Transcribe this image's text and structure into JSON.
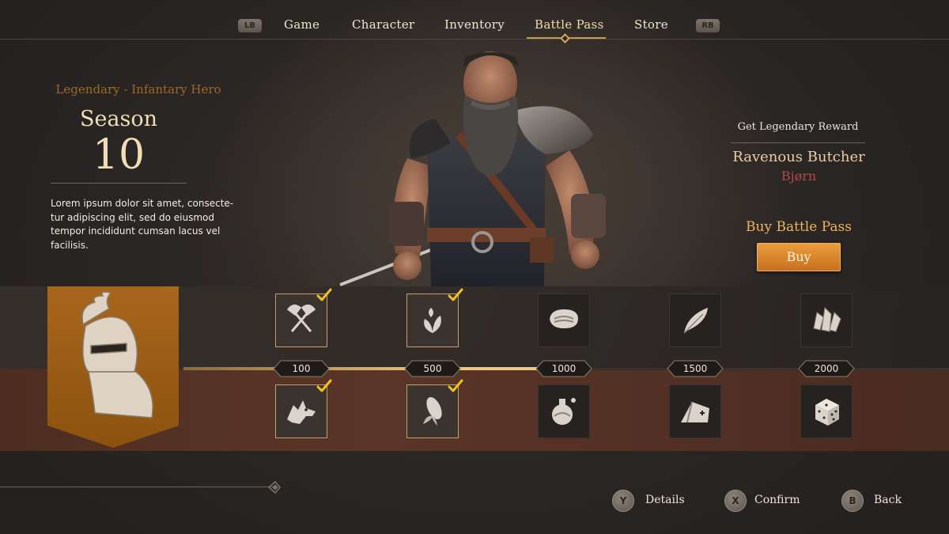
{
  "nav": {
    "left_bumper": "LB",
    "right_bumper": "RB",
    "tabs": [
      {
        "label": "Game"
      },
      {
        "label": "Character"
      },
      {
        "label": "Inventory"
      },
      {
        "label": "Battle Pass"
      },
      {
        "label": "Store"
      }
    ],
    "active_tab": "Battle Pass"
  },
  "season": {
    "rarity": "Legendary - Infantary Hero",
    "label": "Season",
    "number": "10",
    "description": "Lorem ipsum dolor sit amet, consecte-tur adipiscing elit, sed do eiusmod tempor incididunt cumsan lacus vel facilisis."
  },
  "reward": {
    "title": "Get Legendary Reward",
    "name": "Ravenous Butcher",
    "subtitle": "Bjørn"
  },
  "buy": {
    "title": "Buy Battle Pass",
    "button": "Buy"
  },
  "track": {
    "progress_fraction": 0.52,
    "tiers": [
      {
        "label": "100",
        "top_icon": "crossed-axes-icon",
        "bottom_icon": "wolf-icon",
        "top_claimed": true,
        "bottom_claimed": true
      },
      {
        "label": "500",
        "top_icon": "herb-icon",
        "bottom_icon": "corn-icon",
        "top_claimed": true,
        "bottom_claimed": true
      },
      {
        "label": "1000",
        "top_icon": "meat-icon",
        "bottom_icon": "potion-icon",
        "top_claimed": false,
        "bottom_claimed": false
      },
      {
        "label": "1500",
        "top_icon": "feather-icon",
        "bottom_icon": "tent-icon",
        "top_claimed": false,
        "bottom_claimed": false
      },
      {
        "label": "2000",
        "top_icon": "crystals-icon",
        "bottom_icon": "dice-icon",
        "top_claimed": false,
        "bottom_claimed": false
      }
    ]
  },
  "footer": {
    "hints": [
      {
        "button": "Y",
        "label": "Details"
      },
      {
        "button": "X",
        "label": "Confirm"
      },
      {
        "button": "B",
        "label": "Back"
      }
    ]
  },
  "colors": {
    "accent_orange": "#e8923a",
    "gold": "#e8c27a",
    "check_yellow": "#f2c21b",
    "reward_red": "#b04a4a"
  }
}
